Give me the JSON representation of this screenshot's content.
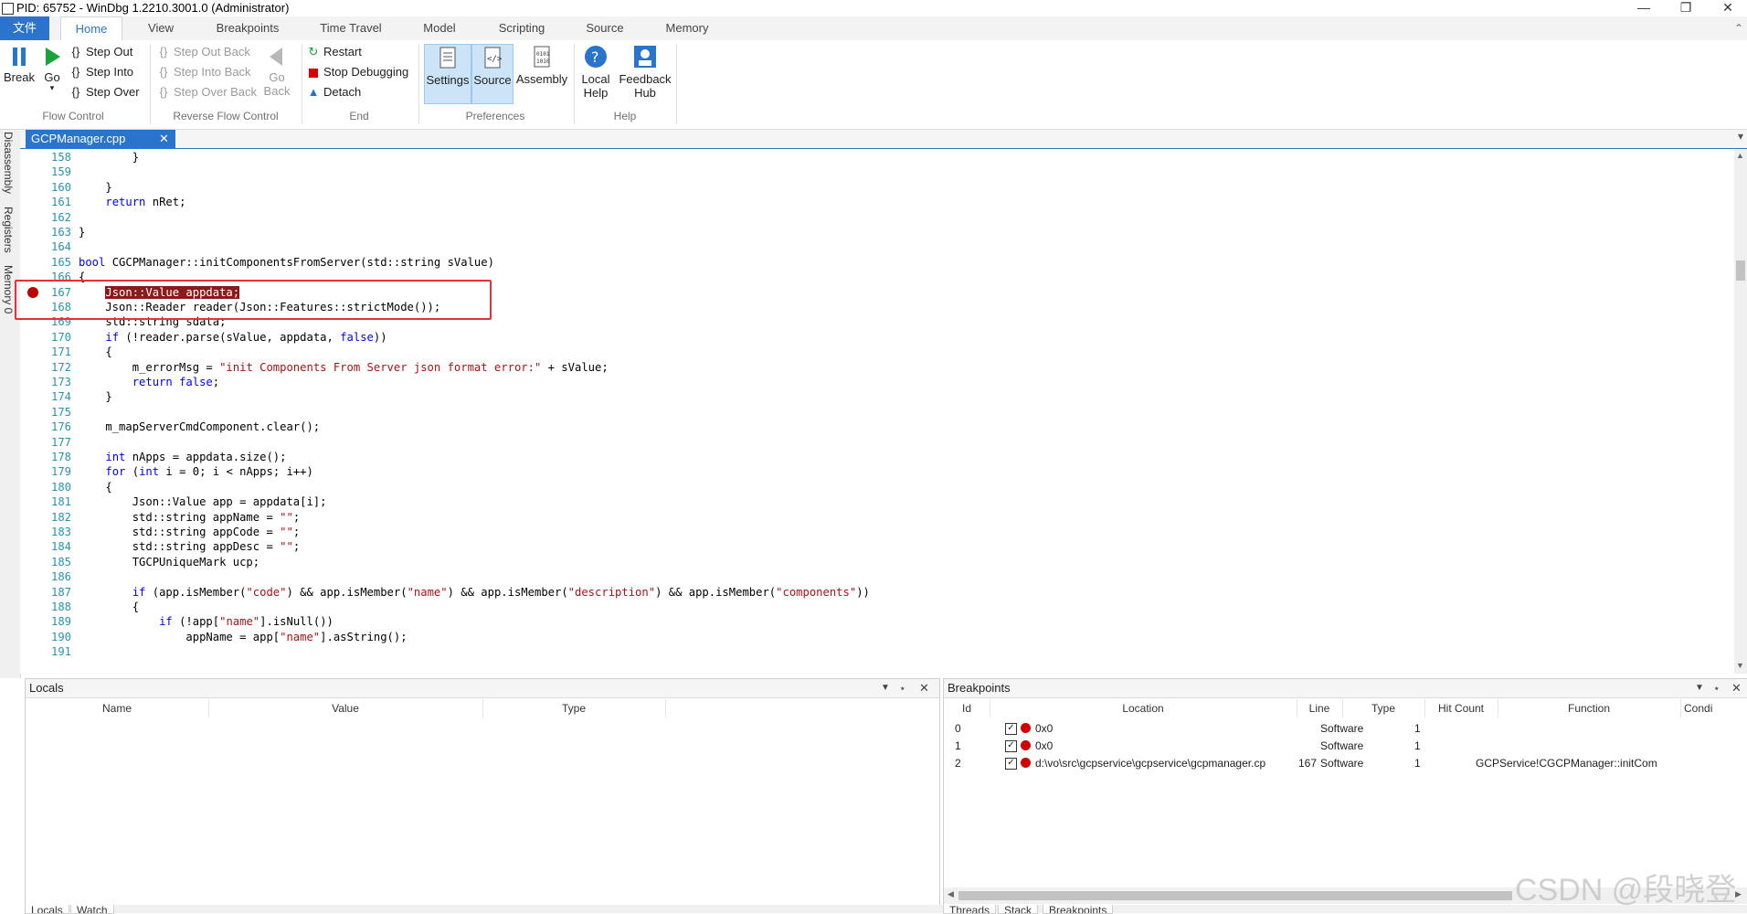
{
  "window": {
    "title": "PID: 65752 - WinDbg 1.2210.3001.0 (Administrator)",
    "controls": [
      "minimize",
      "restore",
      "close"
    ]
  },
  "ribbon_tabs": [
    "文件",
    "Home",
    "View",
    "Breakpoints",
    "Time Travel",
    "Model",
    "Scripting",
    "Source",
    "Memory"
  ],
  "ribbon": {
    "flow_control": {
      "label": "Flow Control",
      "break": "Break",
      "go": "Go",
      "step_out": "Step Out",
      "step_into": "Step Into",
      "step_over": "Step Over"
    },
    "reverse_flow": {
      "label": "Reverse Flow Control",
      "step_out_back": "Step Out Back",
      "step_into_back": "Step Into Back",
      "step_over_back": "Step Over Back",
      "go_back": "Go Back"
    },
    "end": {
      "label": "End",
      "restart": "Restart",
      "stop": "Stop Debugging",
      "detach": "Detach"
    },
    "preferences": {
      "label": "Preferences",
      "settings": "Settings",
      "source": "Source",
      "assembly": "Assembly"
    },
    "help": {
      "label": "Help",
      "local_help": "Local Help",
      "feedback_hub": "Feedback Hub"
    }
  },
  "sidebar_tabs": [
    "Disassembly",
    "Registers",
    "Memory 0"
  ],
  "document_tab": "GCPManager.cpp",
  "code_lines": [
    {
      "n": "158",
      "t": [
        {
          "c": "        }"
        }
      ]
    },
    {
      "n": "159",
      "t": [
        {
          "c": ""
        }
      ]
    },
    {
      "n": "160",
      "t": [
        {
          "c": "    }"
        }
      ]
    },
    {
      "n": "161",
      "t": [
        {
          "c": "    ",
          "k": ""
        },
        {
          "c": "return",
          "k": "kw"
        },
        {
          "c": " nRet;"
        }
      ]
    },
    {
      "n": "162",
      "t": [
        {
          "c": ""
        }
      ]
    },
    {
      "n": "163",
      "t": [
        {
          "c": "}"
        }
      ]
    },
    {
      "n": "164",
      "t": [
        {
          "c": ""
        }
      ]
    },
    {
      "n": "165",
      "t": [
        {
          "c": "bool",
          "k": "kw"
        },
        {
          "c": " CGCPManager::initComponentsFromServer(std::string sValue)"
        }
      ]
    },
    {
      "n": "166",
      "t": [
        {
          "c": "{"
        }
      ]
    },
    {
      "n": "167",
      "t": [
        {
          "c": "    "
        },
        {
          "c": "Json::Value appdata;",
          "k": "hl"
        }
      ],
      "bp": true
    },
    {
      "n": "168",
      "t": [
        {
          "c": "    Json::Reader reader(Json::Features::strictMode());"
        }
      ]
    },
    {
      "n": "169",
      "t": [
        {
          "c": "    std::string sdata;"
        }
      ]
    },
    {
      "n": "170",
      "t": [
        {
          "c": "    "
        },
        {
          "c": "if",
          "k": "kw"
        },
        {
          "c": " (!reader.parse(sValue, appdata, "
        },
        {
          "c": "false",
          "k": "kw"
        },
        {
          "c": "))"
        }
      ]
    },
    {
      "n": "171",
      "t": [
        {
          "c": "    {"
        }
      ]
    },
    {
      "n": "172",
      "t": [
        {
          "c": "        m_errorMsg = "
        },
        {
          "c": "\"init Components From Server json format error:\"",
          "k": "st"
        },
        {
          "c": " + sValue;"
        }
      ]
    },
    {
      "n": "173",
      "t": [
        {
          "c": "        "
        },
        {
          "c": "return",
          "k": "kw"
        },
        {
          "c": " "
        },
        {
          "c": "false",
          "k": "kw"
        },
        {
          "c": ";"
        }
      ]
    },
    {
      "n": "174",
      "t": [
        {
          "c": "    }"
        }
      ]
    },
    {
      "n": "175",
      "t": [
        {
          "c": ""
        }
      ]
    },
    {
      "n": "176",
      "t": [
        {
          "c": "    m_mapServerCmdComponent.clear();"
        }
      ]
    },
    {
      "n": "177",
      "t": [
        {
          "c": ""
        }
      ]
    },
    {
      "n": "178",
      "t": [
        {
          "c": "    "
        },
        {
          "c": "int",
          "k": "kw"
        },
        {
          "c": " nApps = appdata.size();"
        }
      ]
    },
    {
      "n": "179",
      "t": [
        {
          "c": "    "
        },
        {
          "c": "for",
          "k": "kw"
        },
        {
          "c": " ("
        },
        {
          "c": "int",
          "k": "kw"
        },
        {
          "c": " i = 0; i < nApps; i++)"
        }
      ]
    },
    {
      "n": "180",
      "t": [
        {
          "c": "    {"
        }
      ]
    },
    {
      "n": "181",
      "t": [
        {
          "c": "        Json::Value app = appdata[i];"
        }
      ]
    },
    {
      "n": "182",
      "t": [
        {
          "c": "        std::string appName = "
        },
        {
          "c": "\"\"",
          "k": "st"
        },
        {
          "c": ";"
        }
      ]
    },
    {
      "n": "183",
      "t": [
        {
          "c": "        std::string appCode = "
        },
        {
          "c": "\"\"",
          "k": "st"
        },
        {
          "c": ";"
        }
      ]
    },
    {
      "n": "184",
      "t": [
        {
          "c": "        std::string appDesc = "
        },
        {
          "c": "\"\"",
          "k": "st"
        },
        {
          "c": ";"
        }
      ]
    },
    {
      "n": "185",
      "t": [
        {
          "c": "        TGCPUniqueMark ucp;"
        }
      ]
    },
    {
      "n": "186",
      "t": [
        {
          "c": ""
        }
      ]
    },
    {
      "n": "187",
      "t": [
        {
          "c": "        "
        },
        {
          "c": "if",
          "k": "kw"
        },
        {
          "c": " (app.isMember("
        },
        {
          "c": "\"code\"",
          "k": "st"
        },
        {
          "c": ") && app.isMember("
        },
        {
          "c": "\"name\"",
          "k": "st"
        },
        {
          "c": ") && app.isMember("
        },
        {
          "c": "\"description\"",
          "k": "st"
        },
        {
          "c": ") && app.isMember("
        },
        {
          "c": "\"components\"",
          "k": "st"
        },
        {
          "c": "))"
        }
      ]
    },
    {
      "n": "188",
      "t": [
        {
          "c": "        {"
        }
      ]
    },
    {
      "n": "189",
      "t": [
        {
          "c": "            "
        },
        {
          "c": "if",
          "k": "kw"
        },
        {
          "c": " (!app["
        },
        {
          "c": "\"name\"",
          "k": "st"
        },
        {
          "c": "].isNull())"
        }
      ]
    },
    {
      "n": "190",
      "t": [
        {
          "c": "                appName = app["
        },
        {
          "c": "\"name\"",
          "k": "st"
        },
        {
          "c": "].asString();"
        }
      ]
    },
    {
      "n": "191",
      "t": [
        {
          "c": ""
        }
      ]
    }
  ],
  "locals_pane": {
    "title": "Locals",
    "columns": [
      "Name",
      "Value",
      "Type"
    ]
  },
  "breakpoints_pane": {
    "title": "Breakpoints",
    "columns": [
      "Id",
      "Location",
      "Line",
      "Type",
      "Hit Count",
      "Function",
      "Condi"
    ],
    "rows": [
      {
        "id": "0",
        "location": "0x0",
        "line": "",
        "type": "Software",
        "hits": "1",
        "function": ""
      },
      {
        "id": "1",
        "location": "0x0",
        "line": "",
        "type": "Software",
        "hits": "1",
        "function": ""
      },
      {
        "id": "2",
        "location": "d:\\vo\\src\\gcpservice\\gcpservice\\gcpmanager.cp",
        "line": "167",
        "type": "Software",
        "hits": "1",
        "function": "GCPService!CGCPManager::initCom"
      }
    ]
  },
  "bottom_tabs_left": [
    "Locals",
    "Watch"
  ],
  "bottom_tabs_right": [
    "Threads",
    "Stack",
    "Breakpoints"
  ],
  "watermark": "CSDN @段晓登",
  "colors": {
    "accent": "#2b74cc",
    "breakpoint": "#c00000",
    "keyword": "#0000ff",
    "string": "#a31515",
    "line_number": "#2b91af"
  }
}
